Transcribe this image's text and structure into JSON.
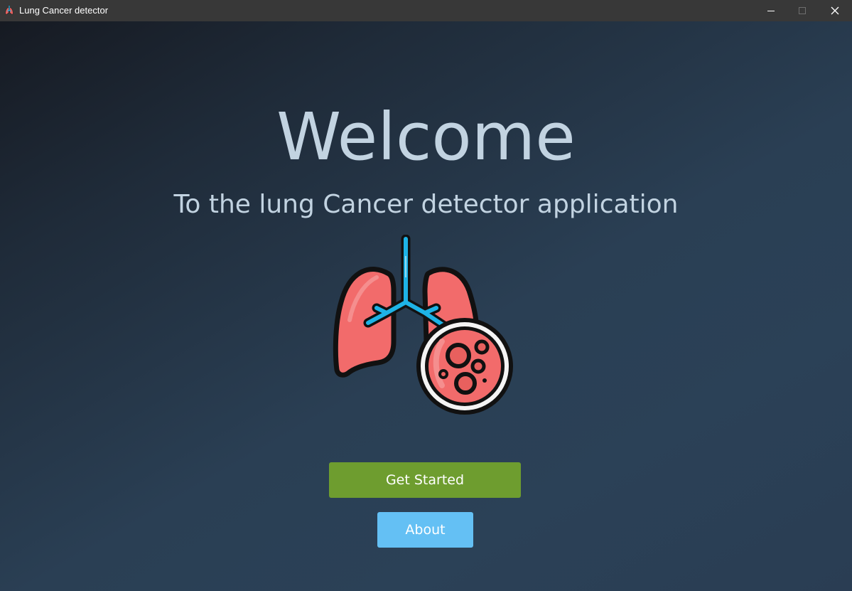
{
  "window": {
    "title": "Lung Cancer detector",
    "icon": "lungs-icon",
    "controls": [
      "minimize-icon",
      "maximize-icon",
      "close-icon"
    ]
  },
  "main": {
    "heading": "Welcome",
    "subtitle": "To the lung Cancer detector application",
    "illustration": "lungs-with-cancer-cells-icon",
    "buttons": {
      "get_started_label": "Get Started",
      "about_label": "About"
    }
  },
  "colors": {
    "heading_text": "#c2d3e1",
    "get_started_bg": "#6e9d2f",
    "about_bg": "#64c0f4",
    "lung_red": "#f26b6b",
    "airway_blue": "#1eb3e6"
  }
}
